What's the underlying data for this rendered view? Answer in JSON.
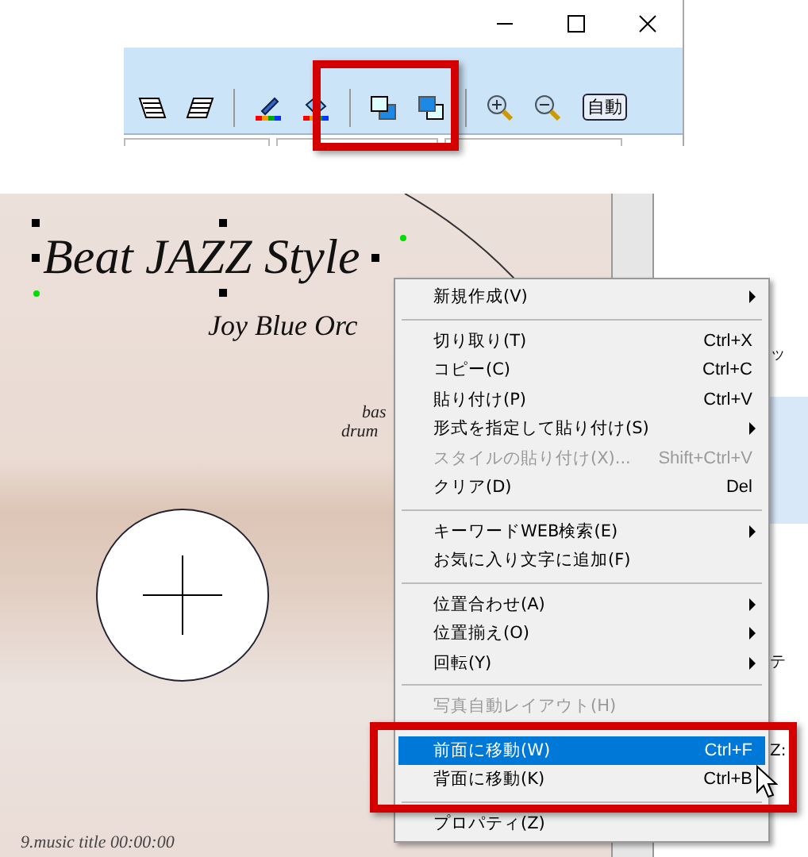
{
  "toolbar": {
    "auto_button": "自動"
  },
  "canvas": {
    "title": "Beat JAZZ Style",
    "subtitle": "Joy Blue Orc",
    "credit_lines": [
      "bas",
      "drum"
    ],
    "track_line": "9.music title 00:00:00"
  },
  "side_panel": {
    "snippets": [
      "ッ",
      "テ",
      "Z:"
    ]
  },
  "context_menu": {
    "items": [
      {
        "kind": "item",
        "label": "新規作成(V)",
        "submenu": true,
        "disabled": false,
        "selected": false
      },
      {
        "kind": "separator"
      },
      {
        "kind": "item",
        "label": "切り取り(T)",
        "shortcut": "Ctrl+X",
        "submenu": false,
        "disabled": false,
        "selected": false
      },
      {
        "kind": "item",
        "label": "コピー(C)",
        "shortcut": "Ctrl+C",
        "submenu": false,
        "disabled": false,
        "selected": false
      },
      {
        "kind": "item",
        "label": "貼り付け(P)",
        "shortcut": "Ctrl+V",
        "submenu": false,
        "disabled": false,
        "selected": false
      },
      {
        "kind": "item",
        "label": "形式を指定して貼り付け(S)",
        "submenu": true,
        "disabled": false,
        "selected": false
      },
      {
        "kind": "item",
        "label": "スタイルの貼り付け(X)...",
        "shortcut": "Shift+Ctrl+V",
        "submenu": false,
        "disabled": true,
        "selected": false
      },
      {
        "kind": "item",
        "label": "クリア(D)",
        "shortcut": "Del",
        "submenu": false,
        "disabled": false,
        "selected": false
      },
      {
        "kind": "separator"
      },
      {
        "kind": "item",
        "label": "キーワードWEB検索(E)",
        "submenu": true,
        "disabled": false,
        "selected": false
      },
      {
        "kind": "item",
        "label": "お気に入り文字に追加(F)",
        "submenu": false,
        "disabled": false,
        "selected": false
      },
      {
        "kind": "separator"
      },
      {
        "kind": "item",
        "label": "位置合わせ(A)",
        "submenu": true,
        "disabled": false,
        "selected": false
      },
      {
        "kind": "item",
        "label": "位置揃え(O)",
        "submenu": true,
        "disabled": false,
        "selected": false
      },
      {
        "kind": "item",
        "label": "回転(Y)",
        "submenu": true,
        "disabled": false,
        "selected": false
      },
      {
        "kind": "separator"
      },
      {
        "kind": "item",
        "label": "写真自動レイアウト(H)",
        "submenu": false,
        "disabled": true,
        "selected": false
      },
      {
        "kind": "separator"
      },
      {
        "kind": "item",
        "label": "前面に移動(W)",
        "shortcut": "Ctrl+F",
        "submenu": false,
        "disabled": false,
        "selected": true
      },
      {
        "kind": "item",
        "label": "背面に移動(K)",
        "shortcut": "Ctrl+B",
        "submenu": false,
        "disabled": false,
        "selected": false
      },
      {
        "kind": "separator"
      },
      {
        "kind": "item",
        "label": "プロパティ(Z)",
        "submenu": false,
        "disabled": false,
        "selected": false
      }
    ]
  }
}
